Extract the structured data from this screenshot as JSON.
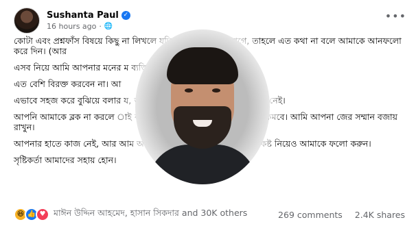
{
  "post": {
    "author": "Sushanta Paul",
    "timestamp": "16 hours ago",
    "paragraphs": [
      "কোটা এবং প্রশ্নফাঁস বিষয়ে কিছু না লিখলে যদি আপনার খারাপ লাগে, তাহলে এত কথা না বলে আমাকে আনফলো করে দিন। (আর",
      "এসব নিয়ে আমি আপনার মনের ম                                             ব্যক্তিগত সিদ্ধান্ত।",
      "এত বেশি বিরক্ত করবেন না। আ",
      "এভাবে সহজ করে বুঝিয়ে বলার                                              য, আপনার কোনো লজ্জাশরম ও কাণ্ডজ্ঞান নেই।",
      "আপনি আমাকে ব্লক না করলে                                                াই করব। এতে আপনার সম্মান বাড়বে না, কমবে। আমি আপনা                        জের সম্মান বজায় রাখুন।",
      "আপনার হাতে কাজ নেই, আর আম                                           আমি চাইছি না যে, আপনি মনে এত কষ্ট নিয়েও আমাকে ফলো করুন।",
      "সৃষ্টিকর্তা আমাদের সহায় হোন।"
    ],
    "reactions_text": "মাঈন উদ্দিন আহমেদ, হাসান সিকদার and 30K others",
    "comments": "269 comments",
    "shares": "2.4K shares"
  }
}
